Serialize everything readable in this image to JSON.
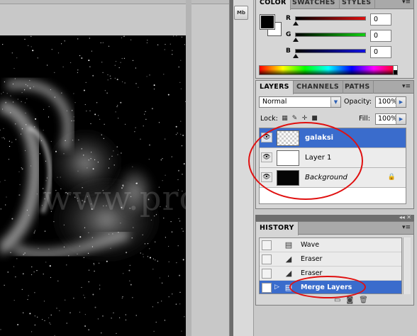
{
  "document": {
    "watermark": "www.programla.com"
  },
  "dock": {
    "button_text": "Mb"
  },
  "color_panel": {
    "tabs": [
      "COLOR",
      "SWATCHES",
      "STYLES"
    ],
    "active_tab": "COLOR",
    "menu_icon": "panel-menu-icon",
    "foreground_color": "#000000",
    "background_color": "#ffffff",
    "channels": [
      {
        "label": "R",
        "value": "0"
      },
      {
        "label": "G",
        "value": "0"
      },
      {
        "label": "B",
        "value": "0"
      }
    ]
  },
  "layers_panel": {
    "tabs": [
      "LAYERS",
      "CHANNELS",
      "PATHS"
    ],
    "active_tab": "LAYERS",
    "blend_mode": "Normal",
    "opacity_label": "Opacity:",
    "opacity_value": "100%",
    "lock_label": "Lock:",
    "fill_label": "Fill:",
    "fill_value": "100%",
    "layers": [
      {
        "name": "galaksi",
        "thumbnail": "transparent",
        "visible": true,
        "selected": true
      },
      {
        "name": "Layer 1",
        "thumbnail": "white",
        "visible": true,
        "selected": false
      },
      {
        "name": "Background",
        "thumbnail": "black",
        "visible": true,
        "selected": false,
        "locked": true
      }
    ]
  },
  "history_panel": {
    "title": "HISTORY",
    "collapse_icon": "double-arrow-icon",
    "items": [
      {
        "label": "Wave",
        "icon": "document-icon",
        "selected": false
      },
      {
        "label": "Eraser",
        "icon": "eraser-icon",
        "selected": false
      },
      {
        "label": "Eraser",
        "icon": "eraser-icon",
        "selected": false
      },
      {
        "label": "Merge Layers",
        "icon": "document-icon",
        "selected": true
      }
    ]
  },
  "colors": {
    "selection_blue": "#3a6ccc",
    "annotation_red": "#e01010",
    "slider_red": "#d01010",
    "slider_green": "#10c010",
    "slider_blue": "#1010d0"
  }
}
